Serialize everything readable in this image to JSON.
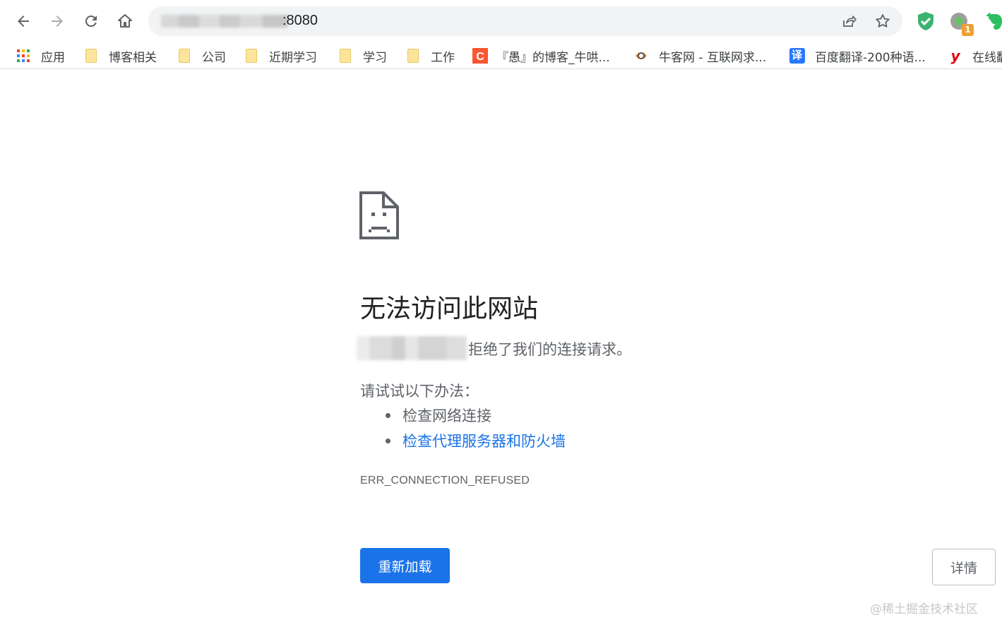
{
  "toolbar": {
    "back_icon": "arrow-left-icon",
    "forward_icon": "arrow-right-icon",
    "reload_icon": "reload-icon",
    "home_icon": "home-icon",
    "url_suffix": ":8080",
    "share_icon": "share-icon",
    "bookmark_star_icon": "star-icon",
    "extensions": [
      {
        "name": "shield-extension-icon",
        "color": "#3cb371"
      },
      {
        "name": "green-circle-extension-icon",
        "badge": "1"
      },
      {
        "name": "evernote-icon",
        "color": "#2dbe60"
      }
    ]
  },
  "bookmarks": [
    {
      "label": "应用",
      "icon": "apps-grid-icon"
    },
    {
      "label": "博客相关",
      "icon": "folder-icon"
    },
    {
      "label": "公司",
      "icon": "folder-icon"
    },
    {
      "label": "近期学习",
      "icon": "folder-icon"
    },
    {
      "label": "学习",
      "icon": "folder-icon"
    },
    {
      "label": "工作",
      "icon": "folder-icon"
    },
    {
      "label": "『愚』的博客_牛哄...",
      "icon": "csdn-icon"
    },
    {
      "label": "牛客网 - 互联网求...",
      "icon": "nowcoder-icon"
    },
    {
      "label": "百度翻译-200种语...",
      "icon": "baidu-translate-icon",
      "icon_text": "译"
    },
    {
      "label": "在线翻",
      "icon": "youdao-icon",
      "icon_text": "y"
    }
  ],
  "error": {
    "title": "无法访问此网站",
    "refused_text": "拒绝了我们的连接请求。",
    "try_text": "请试试以下办法：",
    "suggestions": [
      "检查网络连接",
      "检查代理服务器和防火墙"
    ],
    "code": "ERR_CONNECTION_REFUSED",
    "reload_label": "重新加载",
    "details_label": "详情"
  },
  "watermark": "@稀土掘金技术社区",
  "colors": {
    "accent": "#1a73e8",
    "text_secondary": "#5f6368"
  }
}
